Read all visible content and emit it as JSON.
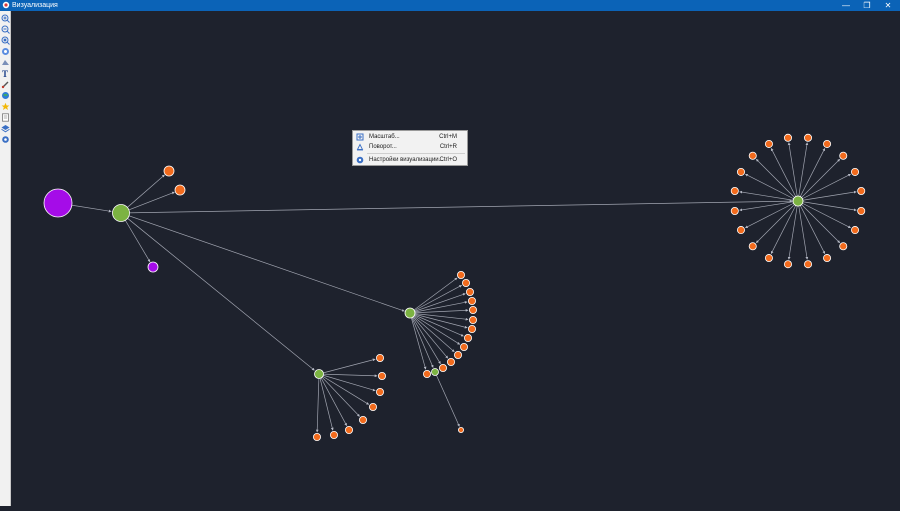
{
  "window": {
    "title": "Визуализация",
    "controls": [
      "—",
      "❐",
      "✕"
    ]
  },
  "toolbar": {
    "tools": [
      "zoom-in-icon",
      "zoom-out-icon",
      "zoom-fit-icon",
      "pan-icon",
      "layout-icon",
      "text-icon",
      "brush-icon",
      "globe-icon",
      "star-icon",
      "document-icon",
      "layers-icon",
      "settings-icon"
    ]
  },
  "context_menu": {
    "items": [
      {
        "label": "Масштаб...",
        "shortcut": "Ctrl+M",
        "icon": "scale-icon"
      },
      {
        "label": "Поворот...",
        "shortcut": "Ctrl+R",
        "icon": "rotate-icon"
      },
      {
        "label": "Настройки визуализации...",
        "shortcut": "Ctrl+O",
        "icon": "visualization-settings-icon"
      }
    ]
  },
  "graph": {
    "node_colors": {
      "root": "#a50ce8",
      "hub": "#7cb342",
      "leaf": "#f26b1d",
      "purple_small": "#a50ce8"
    },
    "edge_color": "#b8bcc8"
  }
}
